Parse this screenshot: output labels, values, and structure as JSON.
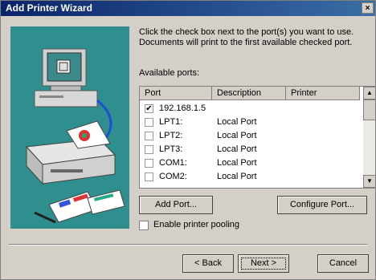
{
  "window": {
    "title": "Add Printer Wizard",
    "close_glyph": "×"
  },
  "instructions": "Click the check box next to the port(s) you want to use. Documents will print to the first available checked port.",
  "available_ports_label": "Available ports:",
  "columns": {
    "port": "Port",
    "description": "Description",
    "printer": "Printer"
  },
  "ports": [
    {
      "checked": true,
      "port": "192.168.1.5",
      "description": "",
      "printer": ""
    },
    {
      "checked": false,
      "port": "LPT1:",
      "description": "Local Port",
      "printer": ""
    },
    {
      "checked": false,
      "port": "LPT2:",
      "description": "Local Port",
      "printer": ""
    },
    {
      "checked": false,
      "port": "LPT3:",
      "description": "Local Port",
      "printer": ""
    },
    {
      "checked": false,
      "port": "COM1:",
      "description": "Local Port",
      "printer": ""
    },
    {
      "checked": false,
      "port": "COM2:",
      "description": "Local Port",
      "printer": ""
    }
  ],
  "buttons": {
    "add_port": "Add Port...",
    "configure_port": "Configure Port...",
    "back": "< Back",
    "next": "Next >",
    "cancel": "Cancel"
  },
  "pooling": {
    "label": "Enable printer pooling",
    "checked": false
  },
  "icons": {
    "checkmark": "✔",
    "scroll_up": "▲",
    "scroll_down": "▼"
  },
  "colors": {
    "titlebar": "#0a246a",
    "face": "#d4d0c8",
    "art_teal": "#2f8f8f"
  }
}
